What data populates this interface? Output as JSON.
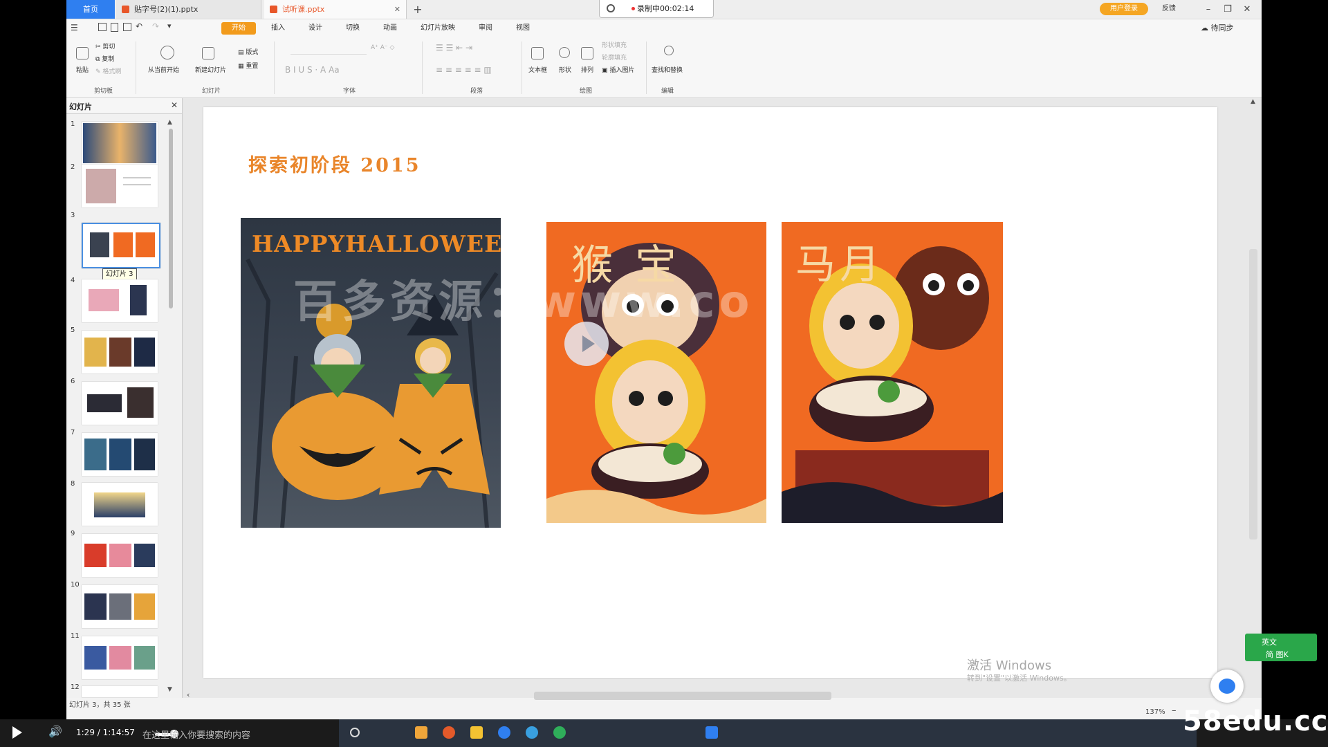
{
  "tabs": {
    "home": "首页",
    "doc1": "贴字号(2)(1).pptx",
    "doc2": "试听课.pptx",
    "new": "+"
  },
  "recorder": {
    "status": "录制中00:02:14"
  },
  "titlebar": {
    "login": "用户登录",
    "feedback": "反馈"
  },
  "menu": {
    "items": [
      "开始",
      "插入",
      "设计",
      "切换",
      "动画",
      "幻灯片放映",
      "审阅",
      "视图"
    ],
    "sync": "待同步"
  },
  "ribbon": {
    "paste": "粘贴",
    "cut": "剪切",
    "copy": "复制",
    "format_painter": "格式刷",
    "from_current": "从当前开始",
    "new_slide": "新建幻灯片",
    "layout": "版式",
    "reset": "重置",
    "text_box": "文本框",
    "shape": "形状",
    "arrange": "排列",
    "shape_fill": "形状填充",
    "outline_fill": "轮廓填充",
    "insert_picture": "插入图片",
    "find_replace": "查找和替换",
    "groups": {
      "clipboard": "剪切板",
      "slides": "幻灯片",
      "font": "字体",
      "paragraph": "段落",
      "drawing": "绘图",
      "editing": "编辑"
    }
  },
  "slide_panel": {
    "title": "幻灯片",
    "numbers": [
      "1",
      "2",
      "3",
      "4",
      "5",
      "6",
      "7",
      "8",
      "9",
      "10",
      "11",
      "12"
    ],
    "selected": 3,
    "tooltip": "幻灯片 3"
  },
  "status": {
    "slide_info": "幻灯片 3，共 35 张",
    "zoom": "137%"
  },
  "slide": {
    "title": "探索初阶段 2015",
    "halloween_text": "HAPPYHALLOWEEN",
    "poster2_text": "猴宝",
    "poster3_text": "马月",
    "watermark": "百多资源：www.co"
  },
  "windows": {
    "activate": "激活 Windows",
    "activate_sub": "转到\"设置\"以激活 Windows。"
  },
  "player": {
    "time": "1:29 / 1:14:57",
    "search_placeholder": "在这里输入你要搜索的内容"
  },
  "site": "58edu.cc",
  "ime": {
    "lang": "英文",
    "mode": "简 图K"
  },
  "colors": {
    "accent_orange": "#f29b1c",
    "title_orange": "#e9852a",
    "wps_blue": "#2f7ff0",
    "poster_orange": "#f06a22"
  }
}
